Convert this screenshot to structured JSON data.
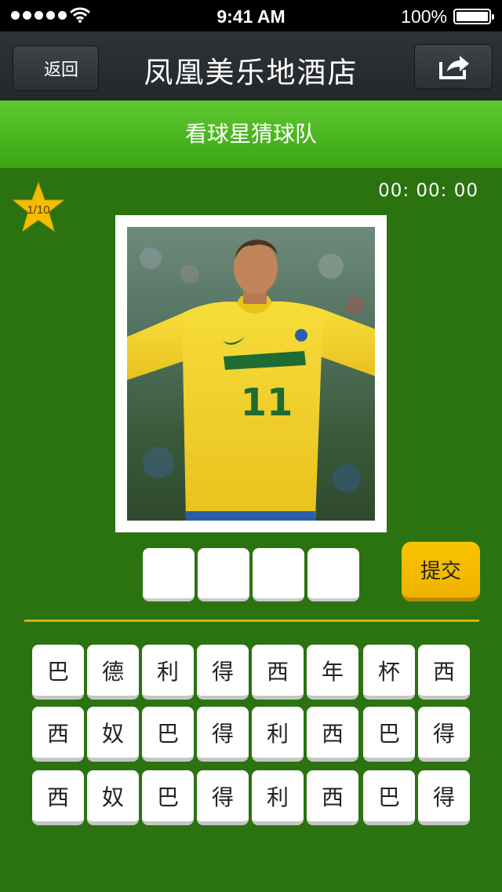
{
  "status_bar": {
    "time": "9:41 AM",
    "battery": "100%"
  },
  "nav": {
    "back_label": "返回",
    "title": "凤凰美乐地酒店"
  },
  "game": {
    "header": "看球星猜球队",
    "progress": "1/10",
    "timer": "00: 00: 00",
    "photo": {
      "jersey_number": "11"
    },
    "answer_slots": [
      "",
      "",
      "",
      ""
    ],
    "submit_label": "提交"
  },
  "char_grid": [
    [
      "巴",
      "德",
      "利",
      "得",
      "西",
      "年",
      "杯",
      "西"
    ],
    [
      "西",
      "奴",
      "巴",
      "得",
      "利",
      "西",
      "巴",
      "得"
    ],
    [
      "西",
      "奴",
      "巴",
      "得",
      "利",
      "西",
      "巴",
      "得"
    ]
  ],
  "colors": {
    "background": "#2a7310",
    "header_green": "#4bb51e",
    "accent_yellow": "#f5bd00",
    "nav_dark": "#2a2e31"
  }
}
